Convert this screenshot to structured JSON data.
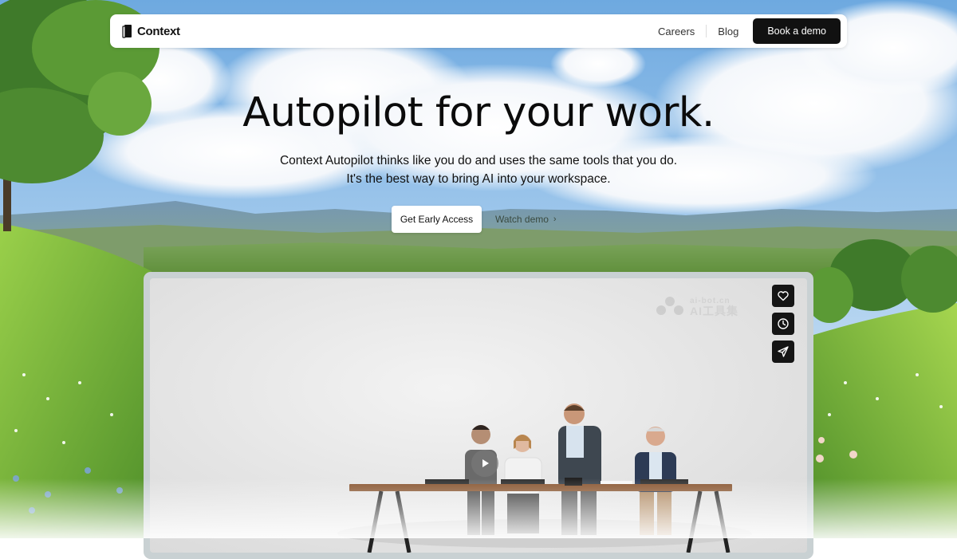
{
  "brand": {
    "name": "Context",
    "logo_icon": "book-logo-icon"
  },
  "nav": {
    "links": [
      "Careers",
      "Blog"
    ],
    "cta_label": "Book a demo"
  },
  "hero": {
    "title": "Autopilot for your work.",
    "subtitle_line1": "Context Autopilot thinks like you do and uses the same tools that you do.",
    "subtitle_line2": "It's the best way to bring AI into your workspace.",
    "primary_cta": "Get Early Access",
    "secondary_cta": "Watch demo",
    "secondary_icon": "chevron-right-icon"
  },
  "video": {
    "play_icon": "play-icon",
    "side_actions": [
      {
        "icon": "heart-icon"
      },
      {
        "icon": "clock-icon"
      },
      {
        "icon": "send-icon"
      }
    ],
    "watermark": {
      "domain": "ai-bot.cn",
      "label": "AI工具集"
    }
  },
  "colors": {
    "nav_bg": "#ffffff",
    "button_dark": "#111111",
    "sky": "#8fc0ea",
    "grass": "#7cc23a"
  }
}
